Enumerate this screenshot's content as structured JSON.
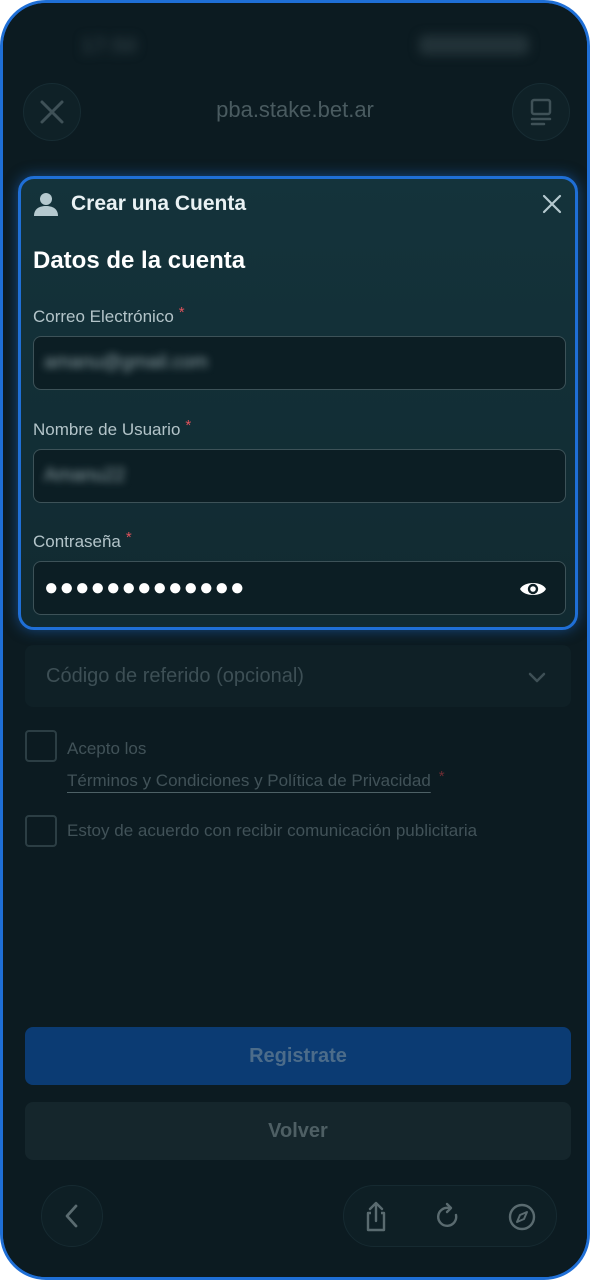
{
  "status_bar": {
    "time": "17:50"
  },
  "browser": {
    "url": "pba.stake.bet.ar"
  },
  "modal": {
    "title": "Crear una Cuenta",
    "section_title": "Datos de la cuenta",
    "fields": [
      {
        "label": "Correo Electrónico",
        "required": "*",
        "value": "amanu@gmail.com"
      },
      {
        "label": "Nombre de Usuario",
        "required": "*",
        "value": "Amanu22"
      },
      {
        "label": "Contraseña",
        "required": "*",
        "value": "●●●●●●●●●●●●●"
      }
    ]
  },
  "form": {
    "referral_placeholder": "Código de referido (opcional)",
    "accept_prefix": "Acepto los",
    "terms_link": "Términos y Condiciones y Política de Privacidad",
    "terms_required": "*",
    "marketing_label": "Estoy de acuerdo con recibir comunicación publicitaria",
    "register_button": "Registrate",
    "back_button": "Volver"
  },
  "colors": {
    "accent": "#1f6fd6",
    "required": "#e0525b",
    "background": "#0c1b21"
  },
  "icons": {
    "close": "close-icon",
    "tabs": "tabs-icon",
    "user": "user-icon",
    "eye": "eye-icon",
    "chevron": "chevron-down-icon",
    "back": "chevron-left-icon",
    "share": "share-icon",
    "reload": "reload-icon",
    "compass": "compass-icon"
  }
}
